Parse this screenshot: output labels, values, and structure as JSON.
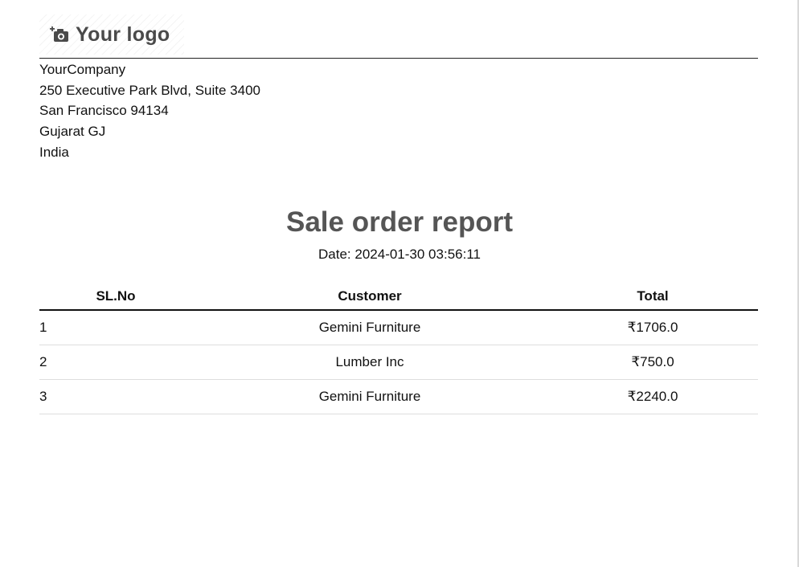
{
  "logo": {
    "text": "Your logo",
    "icon": "camera-plus-icon"
  },
  "company": {
    "name": "YourCompany",
    "street": "250 Executive Park Blvd, Suite 3400",
    "city_zip": "San Francisco 94134",
    "state": "Gujarat GJ",
    "country": "India"
  },
  "report": {
    "title": "Sale order report",
    "date_label": "Date:",
    "date_value": "2024-01-30 03:56:11"
  },
  "table": {
    "headers": {
      "sl_no": "SL.No",
      "customer": "Customer",
      "total": "Total"
    },
    "rows": [
      {
        "sl_no": "1",
        "customer": "Gemini Furniture",
        "total": "₹1706.0"
      },
      {
        "sl_no": "2",
        "customer": "Lumber Inc",
        "total": "₹750.0"
      },
      {
        "sl_no": "3",
        "customer": "Gemini Furniture",
        "total": "₹2240.0"
      }
    ]
  },
  "colors": {
    "title": "#555555",
    "logo_text": "#4a4a4a",
    "rule": "#111111",
    "row_divider": "#dedede"
  }
}
